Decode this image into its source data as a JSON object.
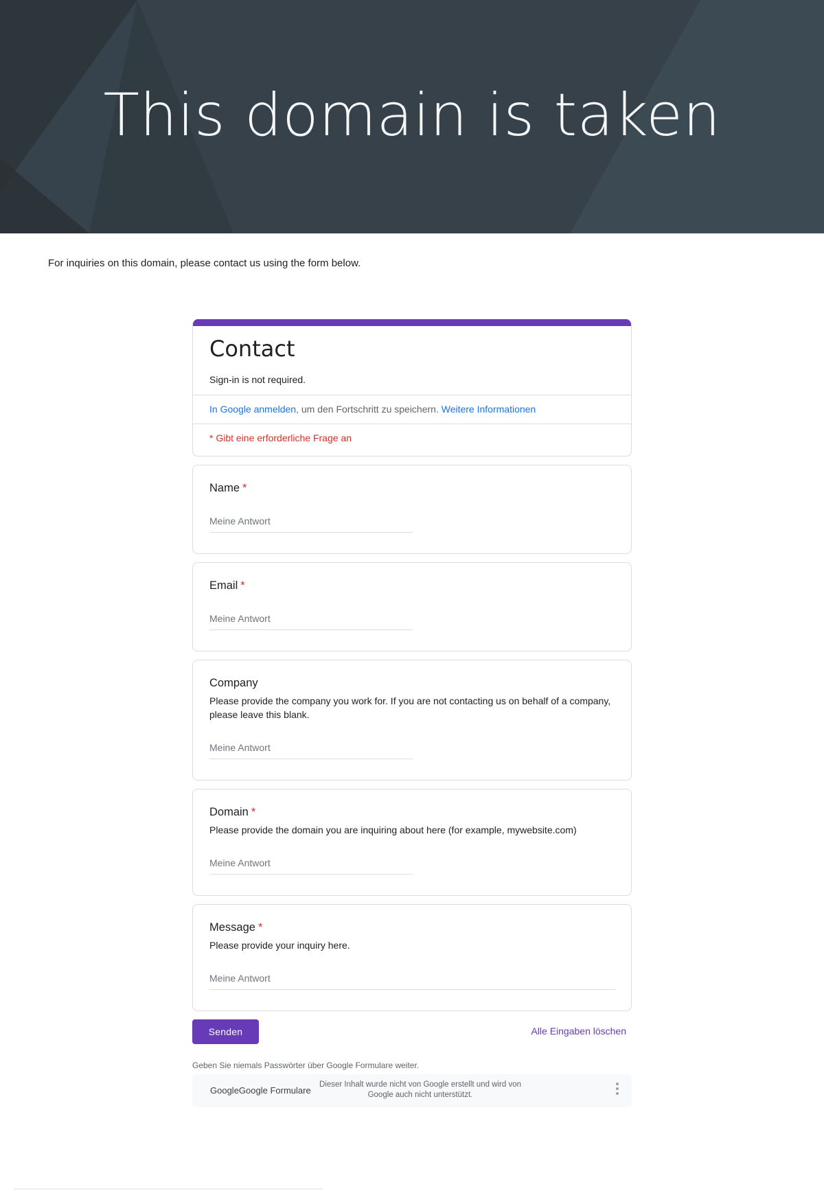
{
  "hero": {
    "title": "This domain is taken"
  },
  "intro": "For inquiries on this domain, please contact us using the form below.",
  "form": {
    "title": "Contact",
    "description": "Sign-in is not required.",
    "signin": {
      "link": "In Google anmelden",
      "text": ", um den Fortschritt zu speichern. ",
      "more_link": "Weitere Informationen"
    },
    "required_note": "* Gibt eine erforderliche Frage an",
    "questions": [
      {
        "title": "Name",
        "required_mark": "*",
        "description": "",
        "placeholder": "Meine Antwort"
      },
      {
        "title": "Email",
        "required_mark": "*",
        "description": "",
        "placeholder": "Meine Antwort"
      },
      {
        "title": "Company",
        "required_mark": "",
        "description": "Please provide the company you work for. If you are not contacting us on behalf of a company, please leave this blank.",
        "placeholder": "Meine Antwort"
      },
      {
        "title": "Domain",
        "required_mark": "*",
        "description": "Please provide the domain you are inquiring about here (for example, mywebsite.com)",
        "placeholder": "Meine Antwort"
      },
      {
        "title": "Message",
        "required_mark": "*",
        "description": "Please provide your inquiry here.",
        "placeholder": "Meine Antwort"
      }
    ],
    "submit_label": "Senden",
    "clear_label": "Alle Eingaben löschen",
    "password_note": "Geben Sie niemals Passwörter über Google Formulare weiter.",
    "footer": {
      "brand_a": "Google",
      "brand_b": "Google Formulare",
      "disclaimer": "Dieser Inhalt wurde nicht von Google erstellt und wird von Google auch nicht unterstützt."
    }
  },
  "colors": {
    "accent": "#673ab7",
    "required": "#d93025",
    "link": "#1a73e8",
    "hero_bg": "#37434c"
  }
}
